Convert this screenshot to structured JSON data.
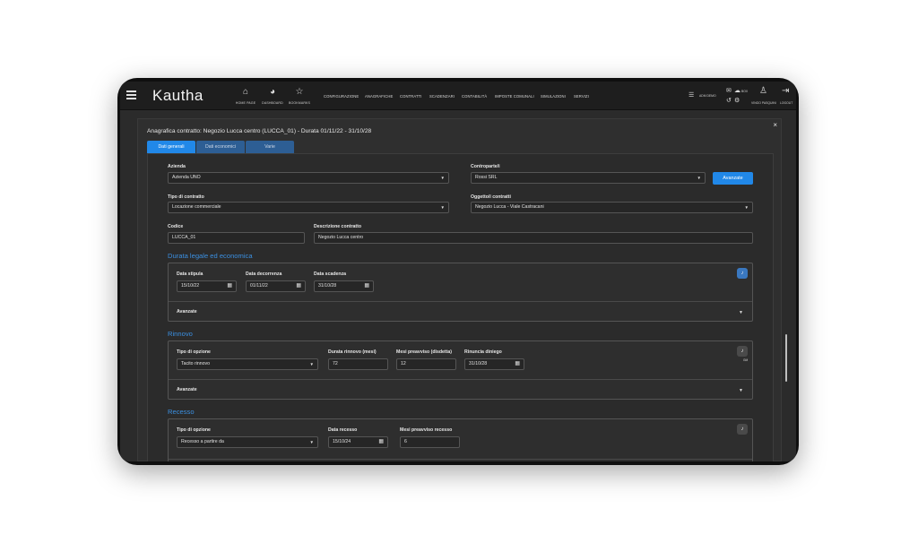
{
  "app": {
    "logo": "Kautha"
  },
  "nav": {
    "home": "HOME PAGE",
    "dashboard": "DASHBOARD",
    "bookmarks": "BOOKMARKS",
    "menu": [
      "CONFIGURAZIONE",
      "ANAGRAFICHE",
      "CONTRATTI",
      "SCADENZARI",
      "CONTABILITÀ",
      "IMPOSTE COMUNALI",
      "SIMULAZIONI",
      "SERVIZI"
    ],
    "company": "ADM DEMO",
    "badge": "BOX",
    "user": "VINGO PASQUINI",
    "logout": "LOGOUT"
  },
  "panel": {
    "title": "Anagrafica contratto: Negozio Lucca centro (LUCCA_01) - Durata 01/11/22 - 31/10/28",
    "close": "×",
    "tabs": [
      "Dati generali",
      "Dati economici",
      "Varie"
    ]
  },
  "form": {
    "azienda_label": "Azienda",
    "azienda_value": "Azienda UNO",
    "controparte_label": "Controparte/i",
    "controparte_value": "Rossi SRL",
    "avanzate_btn": "Avanzate",
    "tipo_contratto_label": "Tipo di contratto",
    "tipo_contratto_value": "Locazione commerciale",
    "oggetto_label": "Oggetto/i contratti",
    "oggetto_value": "Negozio Lucca - Viale Castracani",
    "codice_label": "Codice",
    "codice_value": "LUCCA_01",
    "descrizione_label": "Descrizione contratto",
    "descrizione_value": "Negozio Lucca centro"
  },
  "durata": {
    "title": "Durata legale ed economica",
    "stipula_label": "Data stipula",
    "stipula_value": "15/10/22",
    "decorrenza_label": "Data decorrenza",
    "decorrenza_value": "01/11/22",
    "scadenza_label": "Data scadenza",
    "scadenza_value": "31/10/28",
    "avanzate": "Avanzate"
  },
  "rinnovo": {
    "title": "Rinnovo",
    "tipo_label": "Tipo di opzione",
    "tipo_value": "Tacito rinnovo",
    "durata_label": "Durata rinnovo (mesi)",
    "durata_value": "72",
    "preavviso_label": "Mesi preavviso (disdetta)",
    "preavviso_value": "12",
    "rinuncia_label": "Rinuncia diniego",
    "rinuncia_value": "31/10/28",
    "bell_tag": "GM",
    "avanzate": "Avanzate"
  },
  "recesso": {
    "title": "Recesso",
    "tipo_label": "Tipo di opzione",
    "tipo_value": "Recesso a partire da",
    "data_label": "Data recesso",
    "data_value": "15/10/24",
    "preavviso_label": "Mesi preavviso  recesso",
    "preavviso_value": "6"
  },
  "colors": {
    "accent": "#2188e8",
    "section": "#3b8fe0",
    "bg": "#2b2b2b"
  }
}
